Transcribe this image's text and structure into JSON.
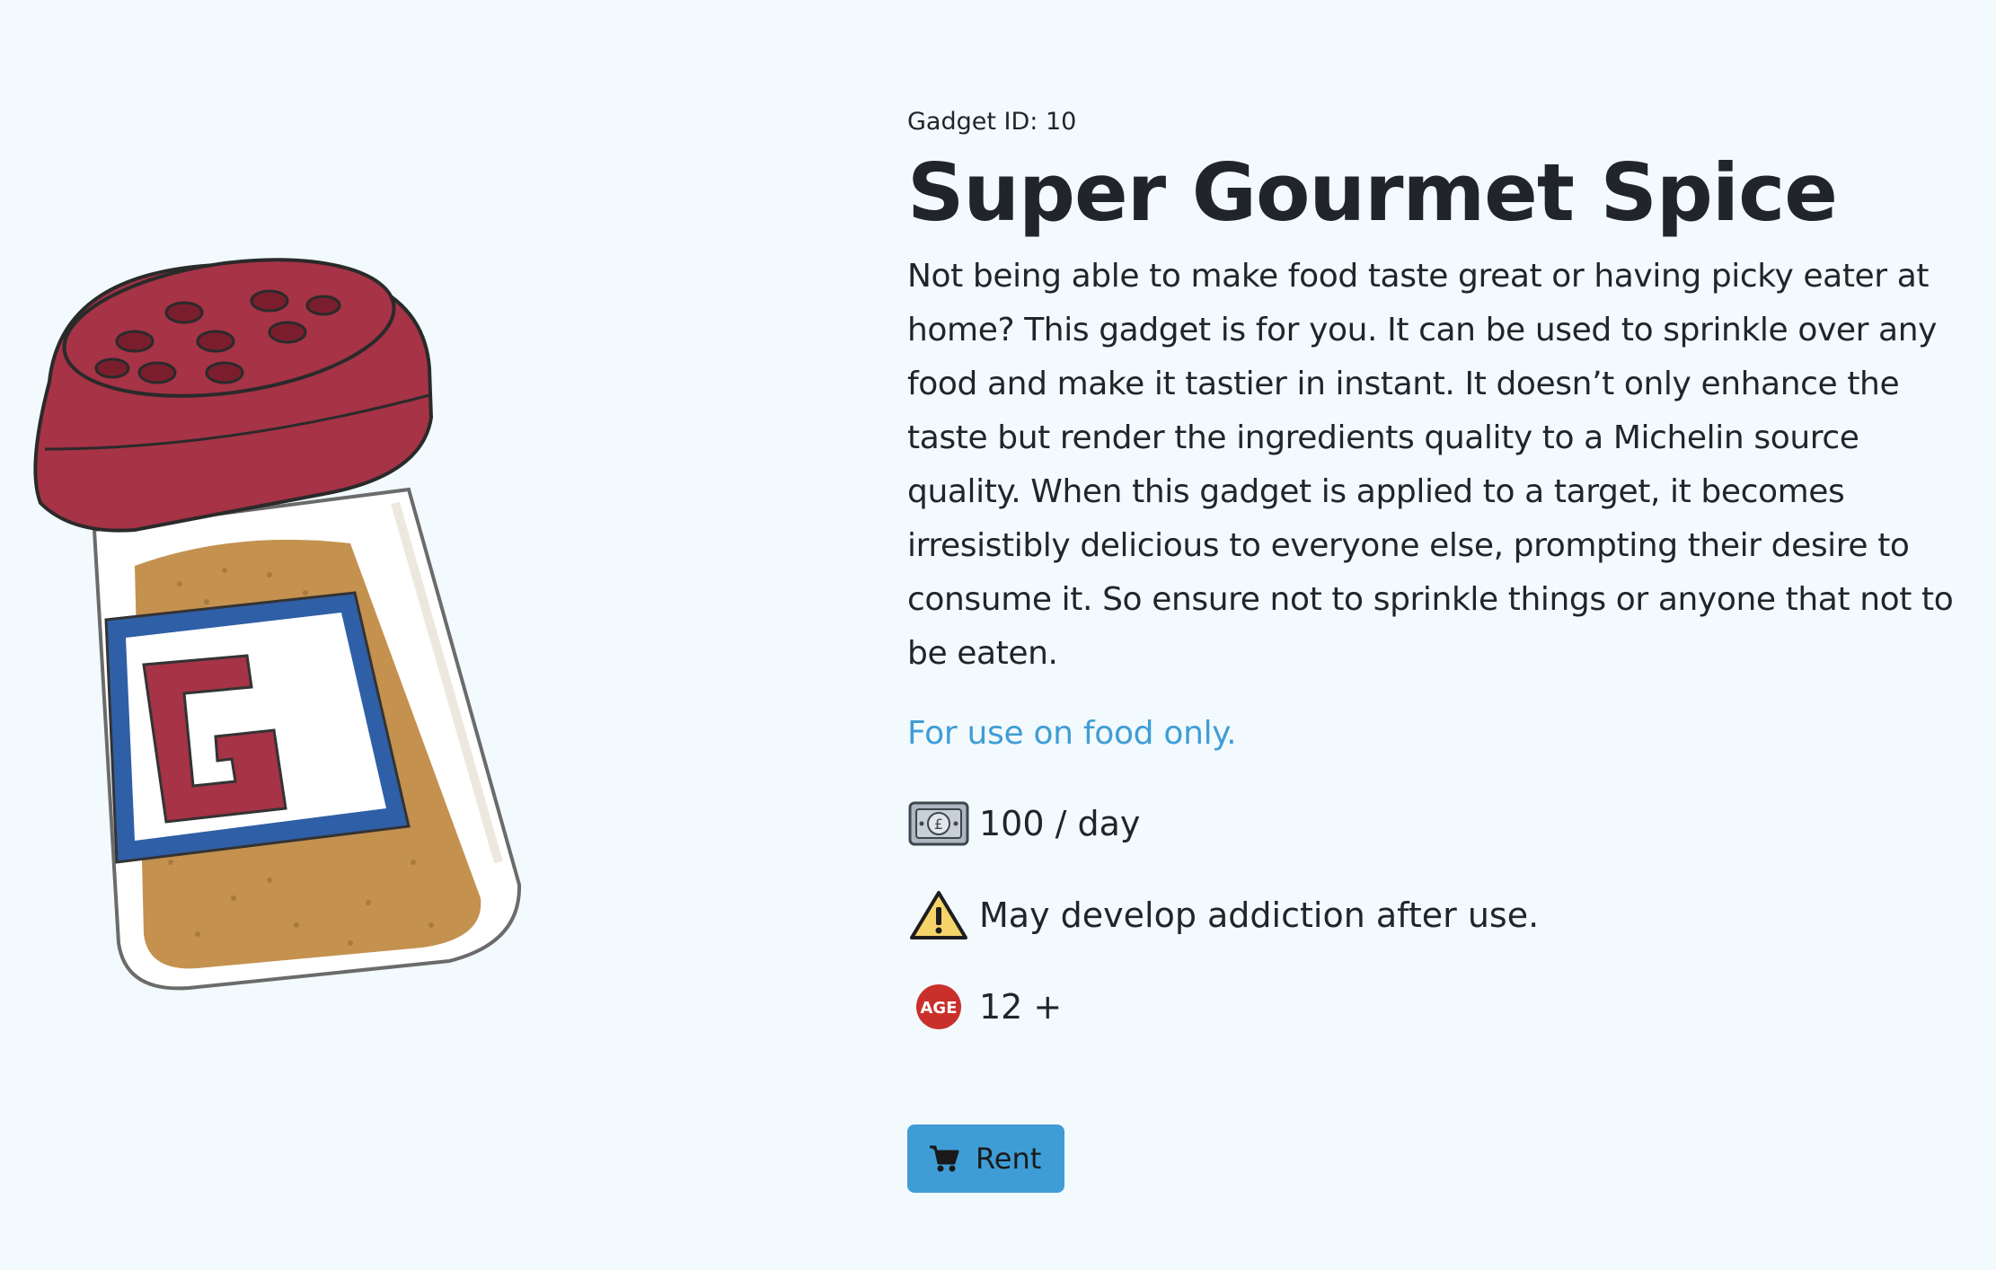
{
  "product": {
    "gadget_id_label": "Gadget ID: 10",
    "title": "Super Gourmet Spice",
    "description": "Not being able to make food taste great or having picky eater at home? This gadget is for you. It can be used to sprinkle over any food and make it tastier in instant. It doesn’t only enhance the taste but render the ingredients quality to a Michelin source quality. When this gadget is applied to a target, it becomes irresistibly delicious to everyone else, prompting their desire to consume it. So ensure not to sprinkle things or anyone that not to be eaten.",
    "usage_note": "For use on food only.",
    "price": "100 / day",
    "warning": "May develop addiction after use.",
    "age_rating": "12 +",
    "age_badge_text": "AGE",
    "rent_label": "Rent",
    "image_label_letter": "G"
  },
  "icons": {
    "price": "banknote-pound-icon",
    "warning": "warning-icon",
    "age": "age-badge-icon",
    "rent": "cart-icon"
  },
  "colors": {
    "background": "#f2fafd",
    "accent": "#3f9dd6",
    "text": "#212529",
    "cap": "#a63346",
    "label_blue": "#2f5fa6",
    "spice": "#c4914f"
  }
}
